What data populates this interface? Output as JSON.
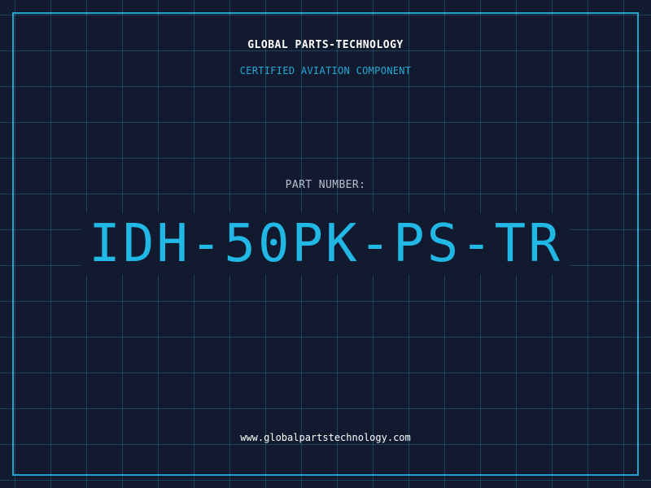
{
  "header": {
    "company": "GLOBAL PARTS-TECHNOLOGY",
    "subtitle": "CERTIFIED AVIATION COMPONENT"
  },
  "part": {
    "label": "PART NUMBER:",
    "number": "IDH-50PK-PS-TR"
  },
  "footer": {
    "website": "www.globalpartstechnology.com"
  },
  "colors": {
    "background": "#111a2e",
    "grid": "#26788f",
    "accent": "#22b8e6",
    "frame": "#1fa3cf"
  }
}
